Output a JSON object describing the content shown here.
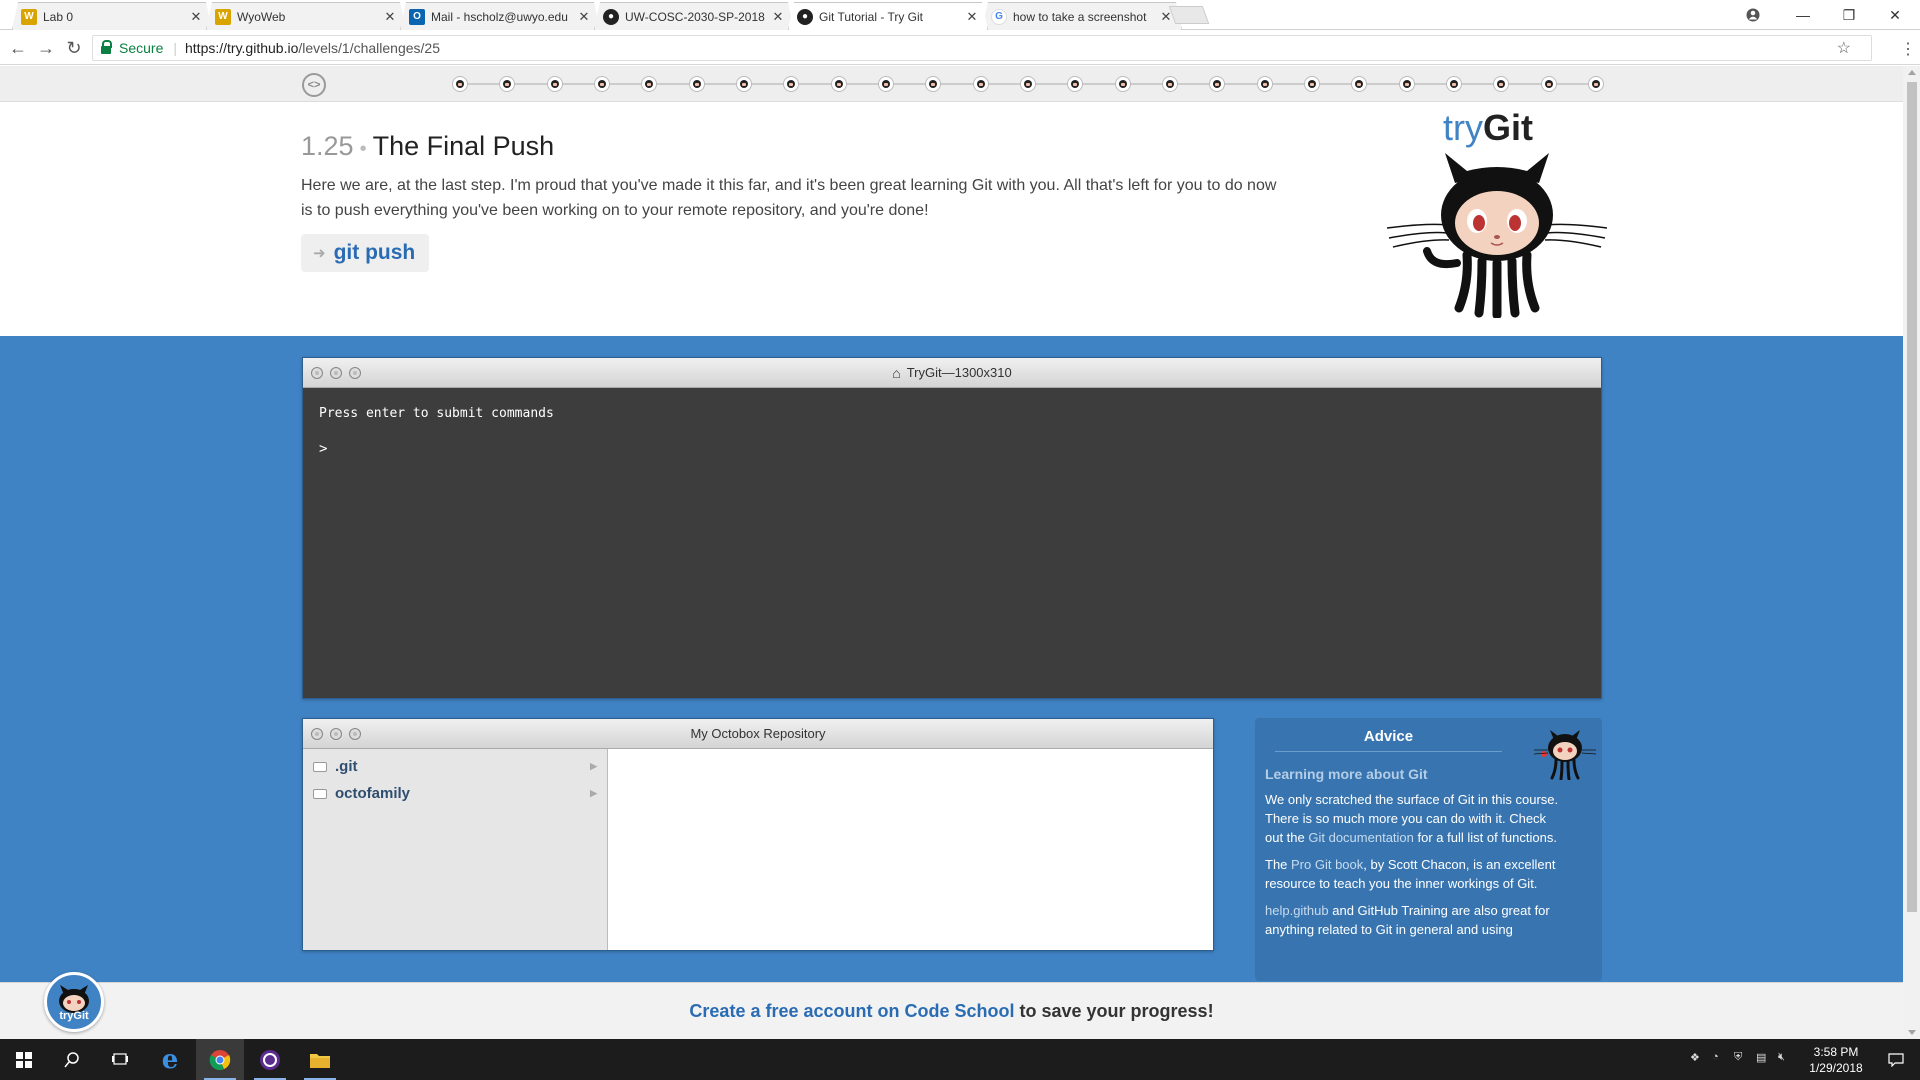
{
  "browser": {
    "tabs": [
      {
        "title": "Lab 0",
        "icon": "wyo-icon",
        "color": "#d9a300"
      },
      {
        "title": "WyoWeb",
        "icon": "wyo-icon",
        "color": "#d9a300"
      },
      {
        "title": "Mail - hscholz@uwyo.edu",
        "icon": "outlook-icon",
        "color": "#0a64b0"
      },
      {
        "title": "UW-COSC-2030-SP-2018",
        "icon": "github-icon",
        "color": "#222222"
      },
      {
        "title": "Git Tutorial - Try Git",
        "icon": "github-icon",
        "color": "#222222",
        "active": true
      },
      {
        "title": "how to take a screenshot",
        "icon": "google-icon",
        "color": "#4285f4"
      }
    ],
    "secure_label": "Secure",
    "url_host": "https://try.github.io",
    "url_path": "/levels/1/challenges/25"
  },
  "progress": {
    "total_steps": 25,
    "current_step": 25
  },
  "challenge": {
    "number": "1.25",
    "title": "The Final Push",
    "description": "Here we are, at the last step. I'm proud that you've made it this far, and it's been great learning Git with you. All that's left for you to do now is to push everything you've been working on to your remote repository, and you're done!",
    "command": "git push"
  },
  "logo": {
    "try": "try",
    "git": "Git"
  },
  "terminal": {
    "title": "TryGit—1300x310",
    "hint": "Press enter to submit commands",
    "prompt": ">"
  },
  "repository": {
    "title": "My Octobox Repository",
    "items": [
      ".git",
      "octofamily"
    ]
  },
  "advice": {
    "title": "Advice",
    "subtitle": "Learning more about Git",
    "p1_a": "We only scratched the surface of Git in this course. There is so much more you can do with it. Check out the ",
    "p1_link": "Git documentation",
    "p1_b": " for a full list of functions.",
    "p2_a": "The ",
    "p2_link": "Pro Git book",
    "p2_b": ", by Scott Chacon, is an excellent resource to teach you the inner workings of Git.",
    "p3_link": "help.github",
    "p3_b": " and GitHub Training are also great for anything related to Git in general and using"
  },
  "footer": {
    "cta": "Create a free account on Code School",
    "rest": "to save your progress!",
    "badge": "tryGit"
  },
  "taskbar": {
    "time": "3:58 PM",
    "date": "1/29/2018"
  },
  "colors": {
    "page_blue": "#4083c4",
    "link_blue": "#2a6cb3",
    "terminal_bg": "#3d3d3d"
  }
}
